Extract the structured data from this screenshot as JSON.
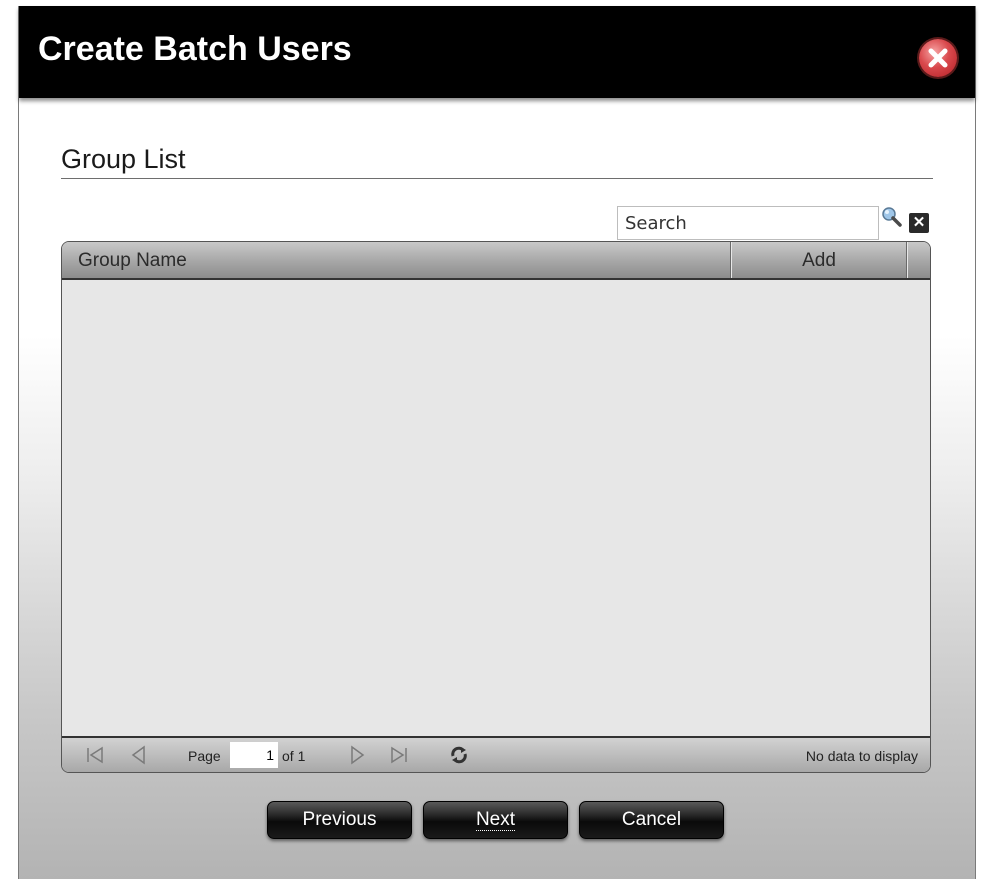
{
  "dialog": {
    "title": "Create Batch Users",
    "close_icon": "close-x-icon"
  },
  "section": {
    "title": "Group List"
  },
  "search": {
    "placeholder": "Search",
    "value": "Search"
  },
  "grid": {
    "columns": [
      "Group Name",
      "Add"
    ],
    "rows": []
  },
  "pager": {
    "page_label": "Page",
    "current_page": "1",
    "of_label": "of 1",
    "status": "No data to display",
    "icons": [
      "first-page-icon",
      "prev-page-icon",
      "next-page-icon",
      "last-page-icon",
      "refresh-icon"
    ]
  },
  "buttons": {
    "previous": "Previous",
    "next": "Next",
    "cancel": "Cancel"
  },
  "colors": {
    "titlebar": "#000000",
    "close": "#d9484c",
    "button": "#1a1a1a"
  }
}
